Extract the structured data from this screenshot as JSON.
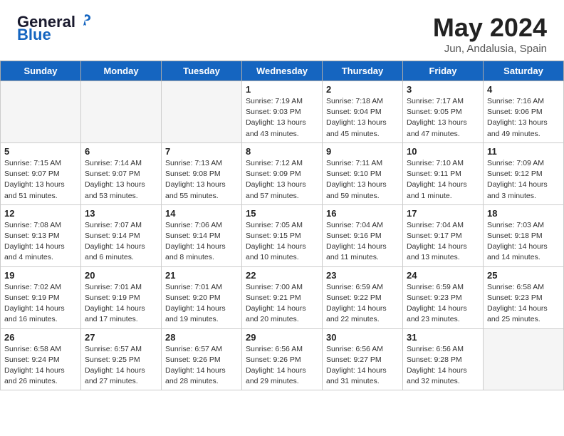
{
  "header": {
    "logo_general": "General",
    "logo_blue": "Blue",
    "month_year": "May 2024",
    "location": "Jun, Andalusia, Spain"
  },
  "weekdays": [
    "Sunday",
    "Monday",
    "Tuesday",
    "Wednesday",
    "Thursday",
    "Friday",
    "Saturday"
  ],
  "weeks": [
    [
      {
        "day": "",
        "info": ""
      },
      {
        "day": "",
        "info": ""
      },
      {
        "day": "",
        "info": ""
      },
      {
        "day": "1",
        "info": "Sunrise: 7:19 AM\nSunset: 9:03 PM\nDaylight: 13 hours\nand 43 minutes."
      },
      {
        "day": "2",
        "info": "Sunrise: 7:18 AM\nSunset: 9:04 PM\nDaylight: 13 hours\nand 45 minutes."
      },
      {
        "day": "3",
        "info": "Sunrise: 7:17 AM\nSunset: 9:05 PM\nDaylight: 13 hours\nand 47 minutes."
      },
      {
        "day": "4",
        "info": "Sunrise: 7:16 AM\nSunset: 9:06 PM\nDaylight: 13 hours\nand 49 minutes."
      }
    ],
    [
      {
        "day": "5",
        "info": "Sunrise: 7:15 AM\nSunset: 9:07 PM\nDaylight: 13 hours\nand 51 minutes."
      },
      {
        "day": "6",
        "info": "Sunrise: 7:14 AM\nSunset: 9:07 PM\nDaylight: 13 hours\nand 53 minutes."
      },
      {
        "day": "7",
        "info": "Sunrise: 7:13 AM\nSunset: 9:08 PM\nDaylight: 13 hours\nand 55 minutes."
      },
      {
        "day": "8",
        "info": "Sunrise: 7:12 AM\nSunset: 9:09 PM\nDaylight: 13 hours\nand 57 minutes."
      },
      {
        "day": "9",
        "info": "Sunrise: 7:11 AM\nSunset: 9:10 PM\nDaylight: 13 hours\nand 59 minutes."
      },
      {
        "day": "10",
        "info": "Sunrise: 7:10 AM\nSunset: 9:11 PM\nDaylight: 14 hours\nand 1 minute."
      },
      {
        "day": "11",
        "info": "Sunrise: 7:09 AM\nSunset: 9:12 PM\nDaylight: 14 hours\nand 3 minutes."
      }
    ],
    [
      {
        "day": "12",
        "info": "Sunrise: 7:08 AM\nSunset: 9:13 PM\nDaylight: 14 hours\nand 4 minutes."
      },
      {
        "day": "13",
        "info": "Sunrise: 7:07 AM\nSunset: 9:14 PM\nDaylight: 14 hours\nand 6 minutes."
      },
      {
        "day": "14",
        "info": "Sunrise: 7:06 AM\nSunset: 9:14 PM\nDaylight: 14 hours\nand 8 minutes."
      },
      {
        "day": "15",
        "info": "Sunrise: 7:05 AM\nSunset: 9:15 PM\nDaylight: 14 hours\nand 10 minutes."
      },
      {
        "day": "16",
        "info": "Sunrise: 7:04 AM\nSunset: 9:16 PM\nDaylight: 14 hours\nand 11 minutes."
      },
      {
        "day": "17",
        "info": "Sunrise: 7:04 AM\nSunset: 9:17 PM\nDaylight: 14 hours\nand 13 minutes."
      },
      {
        "day": "18",
        "info": "Sunrise: 7:03 AM\nSunset: 9:18 PM\nDaylight: 14 hours\nand 14 minutes."
      }
    ],
    [
      {
        "day": "19",
        "info": "Sunrise: 7:02 AM\nSunset: 9:19 PM\nDaylight: 14 hours\nand 16 minutes."
      },
      {
        "day": "20",
        "info": "Sunrise: 7:01 AM\nSunset: 9:19 PM\nDaylight: 14 hours\nand 17 minutes."
      },
      {
        "day": "21",
        "info": "Sunrise: 7:01 AM\nSunset: 9:20 PM\nDaylight: 14 hours\nand 19 minutes."
      },
      {
        "day": "22",
        "info": "Sunrise: 7:00 AM\nSunset: 9:21 PM\nDaylight: 14 hours\nand 20 minutes."
      },
      {
        "day": "23",
        "info": "Sunrise: 6:59 AM\nSunset: 9:22 PM\nDaylight: 14 hours\nand 22 minutes."
      },
      {
        "day": "24",
        "info": "Sunrise: 6:59 AM\nSunset: 9:23 PM\nDaylight: 14 hours\nand 23 minutes."
      },
      {
        "day": "25",
        "info": "Sunrise: 6:58 AM\nSunset: 9:23 PM\nDaylight: 14 hours\nand 25 minutes."
      }
    ],
    [
      {
        "day": "26",
        "info": "Sunrise: 6:58 AM\nSunset: 9:24 PM\nDaylight: 14 hours\nand 26 minutes."
      },
      {
        "day": "27",
        "info": "Sunrise: 6:57 AM\nSunset: 9:25 PM\nDaylight: 14 hours\nand 27 minutes."
      },
      {
        "day": "28",
        "info": "Sunrise: 6:57 AM\nSunset: 9:26 PM\nDaylight: 14 hours\nand 28 minutes."
      },
      {
        "day": "29",
        "info": "Sunrise: 6:56 AM\nSunset: 9:26 PM\nDaylight: 14 hours\nand 29 minutes."
      },
      {
        "day": "30",
        "info": "Sunrise: 6:56 AM\nSunset: 9:27 PM\nDaylight: 14 hours\nand 31 minutes."
      },
      {
        "day": "31",
        "info": "Sunrise: 6:56 AM\nSunset: 9:28 PM\nDaylight: 14 hours\nand 32 minutes."
      },
      {
        "day": "",
        "info": ""
      }
    ]
  ]
}
